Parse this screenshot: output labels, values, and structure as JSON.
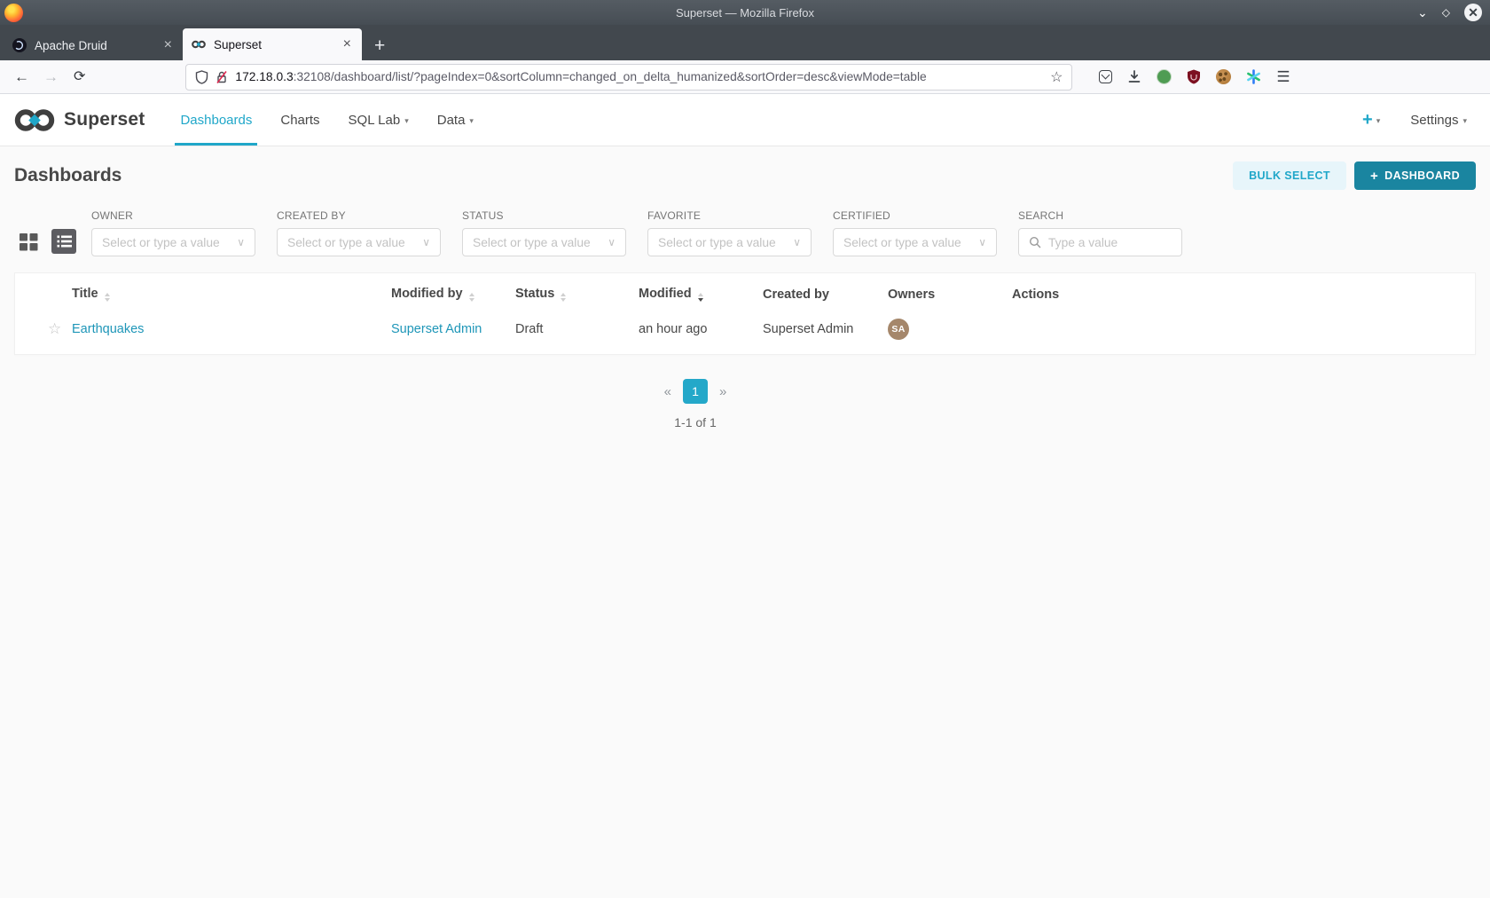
{
  "window": {
    "title": "Superset — Mozilla Firefox",
    "tabs": [
      {
        "label": "Apache Druid"
      },
      {
        "label": "Superset"
      }
    ]
  },
  "browser": {
    "url_host": "172.18.0.3",
    "url_rest": ":32108/dashboard/list/?pageIndex=0&sortColumn=changed_on_delta_humanized&sortOrder=desc&viewMode=table"
  },
  "navbar": {
    "brand": "Superset",
    "items": [
      {
        "label": "Dashboards"
      },
      {
        "label": "Charts"
      },
      {
        "label": "SQL Lab"
      },
      {
        "label": "Data"
      }
    ],
    "settings_label": "Settings"
  },
  "header": {
    "title": "Dashboards",
    "bulk_select_label": "BULK SELECT",
    "dashboard_button_label": "DASHBOARD"
  },
  "filters": [
    {
      "label": "OWNER",
      "placeholder": "Select or type a value"
    },
    {
      "label": "CREATED BY",
      "placeholder": "Select or type a value"
    },
    {
      "label": "STATUS",
      "placeholder": "Select or type a value"
    },
    {
      "label": "FAVORITE",
      "placeholder": "Select or type a value"
    },
    {
      "label": "CERTIFIED",
      "placeholder": "Select or type a value"
    }
  ],
  "search": {
    "label": "SEARCH",
    "placeholder": "Type a value"
  },
  "table": {
    "columns": [
      {
        "label": "Title"
      },
      {
        "label": "Modified by"
      },
      {
        "label": "Status"
      },
      {
        "label": "Modified"
      },
      {
        "label": "Created by"
      },
      {
        "label": "Owners"
      },
      {
        "label": "Actions"
      }
    ],
    "rows": [
      {
        "title": "Earthquakes",
        "modified_by": "Superset Admin",
        "status": "Draft",
        "modified": "an hour ago",
        "created_by": "Superset Admin",
        "owner_initials": "SA"
      }
    ]
  },
  "pagination": {
    "prev": "«",
    "page": "1",
    "next": "»",
    "summary": "1-1 of 1"
  },
  "icons": {
    "window_minimize": "⌄",
    "window_maximize": "◇",
    "window_close": "✕",
    "tab_close": "×",
    "new_tab": "+",
    "back": "←",
    "forward": "→",
    "reload": "⟳",
    "bookmark_star": "☆",
    "hamburger": "☰",
    "caret_down": "▾",
    "chevron_down": "∨",
    "plus": "+",
    "row_star": "☆"
  },
  "colors": {
    "accent": "#20a7c9",
    "primary_button": "#1a85a0",
    "avatar": "#a5876b"
  }
}
